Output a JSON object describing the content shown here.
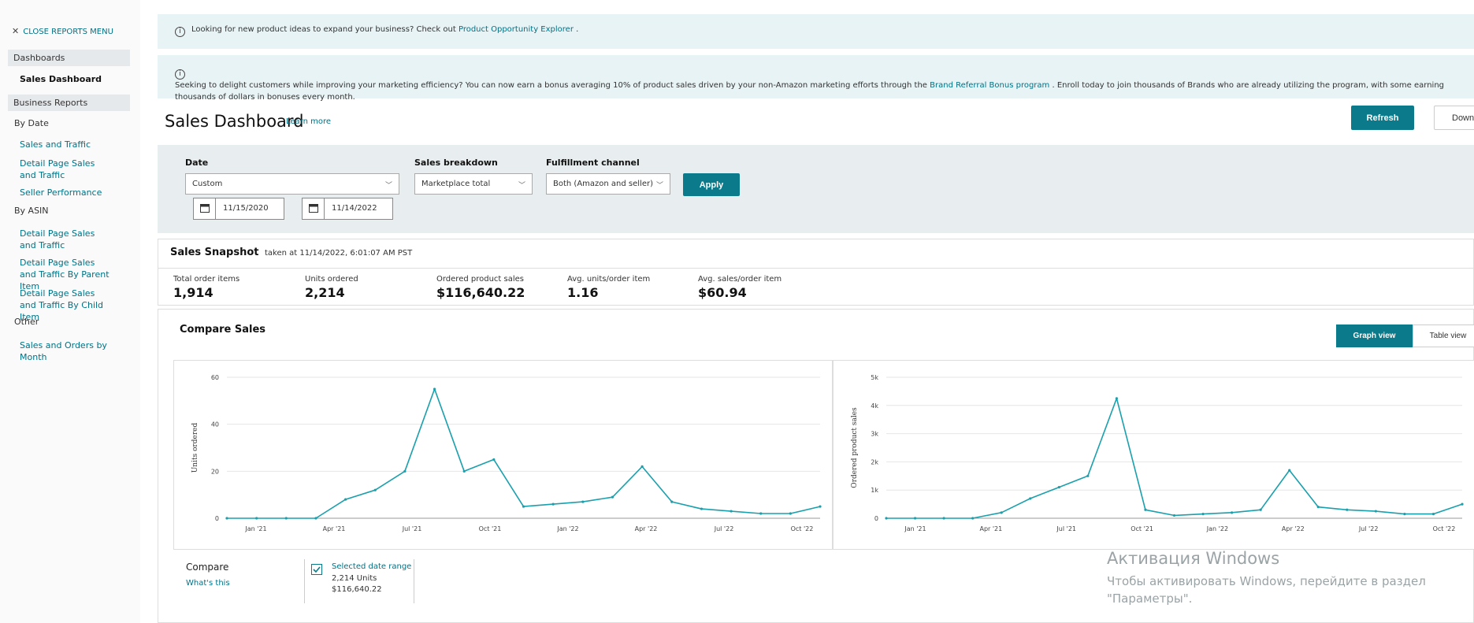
{
  "sidebar": {
    "close_label": "CLOSE REPORTS MENU",
    "dashboards_label": "Dashboards",
    "sales_dashboard_label": "Sales Dashboard",
    "business_reports_label": "Business Reports",
    "by_date_label": "By Date",
    "by_date_items": [
      "Sales and Traffic",
      "Detail Page Sales and Traffic",
      "Seller Performance"
    ],
    "by_asin_label": "By ASIN",
    "by_asin_items": [
      "Detail Page Sales and Traffic",
      "Detail Page Sales and Traffic By Parent Item",
      "Detail Page Sales and Traffic By Child Item"
    ],
    "other_label": "Other",
    "other_items": [
      "Sales and Orders by Month"
    ]
  },
  "banners": {
    "b1_text": "Looking for new product ideas to expand your business? Check out",
    "b1_link": "Product Opportunity Explorer",
    "b1_end": ".",
    "b2_text": "Seeking to delight customers while improving your marketing efficiency? You can now earn a bonus averaging 10% of product sales driven by your non-Amazon marketing efforts through the",
    "b2_link": "Brand Referral Bonus program",
    "b2_end": ". Enroll today to join thousands of Brands who are already utilizing the program, with some earning thousands of dollars in bonuses every month."
  },
  "header": {
    "title": "Sales Dashboard",
    "learn_more": "Learn more",
    "refresh_label": "Refresh",
    "download_label": "Download"
  },
  "filters": {
    "date_label": "Date",
    "date_value": "Custom",
    "breakdown_label": "Sales breakdown",
    "breakdown_value": "Marketplace total",
    "channel_label": "Fulfillment channel",
    "channel_value": "Both (Amazon and seller)",
    "apply_label": "Apply",
    "start_date": "11/15/2020",
    "end_date": "11/14/2022"
  },
  "snapshot": {
    "title": "Sales Snapshot",
    "taken_at": "taken at 11/14/2022, 6:01:07 AM PST",
    "metrics": [
      {
        "label": "Total order items",
        "value": "1,914"
      },
      {
        "label": "Units ordered",
        "value": "2,214"
      },
      {
        "label": "Ordered product sales",
        "value": "$116,640.22"
      },
      {
        "label": "Avg. units/order item",
        "value": "1.16"
      },
      {
        "label": "Avg. sales/order item",
        "value": "$60.94"
      }
    ]
  },
  "compare": {
    "title": "Compare Sales",
    "graph_view": "Graph view",
    "table_view": "Table view",
    "compare_label": "Compare",
    "whats_this": "What's this",
    "selected_range_label": "Selected date range",
    "selected_units": "2,214 Units",
    "selected_sales": "$116,640.22"
  },
  "chart_data": [
    {
      "type": "line",
      "ylabel": "Units ordered",
      "yticks": [
        "0",
        "20",
        "40",
        "60"
      ],
      "ylim": [
        0,
        60
      ],
      "xticks": [
        "Jan '21",
        "Apr '21",
        "Jul '21",
        "Oct '21",
        "Jan '22",
        "Apr '22",
        "Jul '22",
        "Oct '22"
      ],
      "grid": true,
      "x": [
        "Nov '20",
        "Jan '21",
        "Apr '21",
        "Jun '21",
        "Jul '21",
        "Aug '21",
        "Sep '21",
        "Oct '21",
        "Nov '21",
        "Dec '21",
        "Jan '22",
        "Feb '22",
        "Mar '22",
        "Apr '22",
        "May '22",
        "Jun '22",
        "Jul '22",
        "Aug '22",
        "Sep '22",
        "Oct '22",
        "Nov '22"
      ],
      "values": [
        0,
        0,
        0,
        0,
        8,
        12,
        20,
        55,
        20,
        25,
        5,
        6,
        7,
        9,
        22,
        7,
        4,
        3,
        2,
        2,
        5
      ],
      "color": "#1aa0ad"
    },
    {
      "type": "line",
      "ylabel": "Ordered product sales",
      "yticks": [
        "0",
        "1k",
        "2k",
        "3k",
        "4k",
        "5k"
      ],
      "ylim": [
        0,
        5000
      ],
      "xticks": [
        "Jan '21",
        "Apr '21",
        "Jul '21",
        "Oct '21",
        "Jan '22",
        "Apr '22",
        "Jul '22",
        "Oct '22"
      ],
      "grid": true,
      "x": [
        "Nov '20",
        "Jan '21",
        "Apr '21",
        "Jun '21",
        "Jul '21",
        "Aug '21",
        "Sep '21",
        "Oct '21",
        "Nov '21",
        "Dec '21",
        "Jan '22",
        "Feb '22",
        "Mar '22",
        "Apr '22",
        "May '22",
        "Jun '22",
        "Jul '22",
        "Aug '22",
        "Sep '22",
        "Oct '22",
        "Nov '22"
      ],
      "values": [
        0,
        0,
        0,
        0,
        200,
        700,
        1100,
        1500,
        4250,
        300,
        100,
        150,
        200,
        300,
        1700,
        400,
        300,
        250,
        150,
        150,
        500
      ],
      "color": "#1aa0ad"
    }
  ],
  "watermark": {
    "title": "Активация Windows",
    "text": "Чтобы активировать Windows, перейдите в раздел \"Параметры\"."
  }
}
